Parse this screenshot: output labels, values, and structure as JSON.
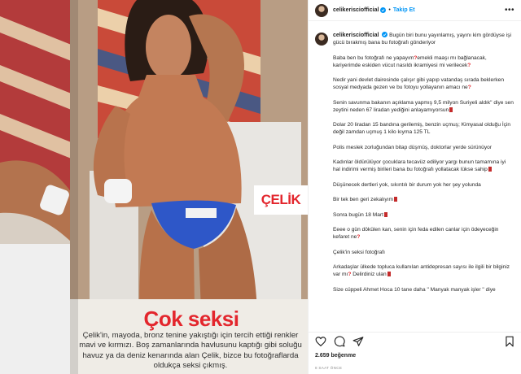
{
  "post": {
    "username": "celikerisciofficial",
    "follow_label": "Takip Et",
    "dot": "•",
    "more_icon": "more-icon",
    "likes": "2.659 beğenme",
    "time": "8 SAAT ÖNCE",
    "caption": {
      "p1": "Bugün biri bunu yayınlamış, yayını kim gördüyse işi gücü bırakmış bana bu fotoğrafı gönderiyor",
      "p2a": "Baba ben bu fotoğrafı ne yapayım",
      "p2b": "emekli maaşı mı bağlanacak, kariyerimde eskiden vücut nasıldı ikramiyesi mi verilecek",
      "p3a": "Nedir yani devlet dairesinde çalışır gibi yapıp vatandaş sırada beklerken sosyal medyada gezen ve bu fotoyu yollayanın amacı ne",
      "p4": "Senin savunma bakanın açıklama yapmış 9,5 milyon Suriyeli aldık\" diye sen zeytini neden 67 liradan yediğini anlayamıyorsun",
      "p5": "Dolar 20 liradan 15 bandına gerilemiş, benzin uçmuş; Kimyasal olduğu İçin değil zamdan uçmuş 1 kilo kıyma 125 TL",
      "p6": "Polis meslek zorluğundan bitap düşmüş, doktorlar yerde sürünüyor",
      "p7": "Kadınlar öldürülüyor çocuklara tecavüz ediliyor yargı bunun tamamına iyi hal indirimi vermiş birileri bana bu fotoğrafı yollatacak lükse sahip",
      "p8": "Düşünecek dertleri yok, sıkıntılı bir durum yok her şey yolunda",
      "p9": "Bir tek ben geri zekalıyım",
      "p10": "Sonra bugün 18 Mart",
      "p11": "Eeee o gün dökülen kan, senin için feda edilen canlar için ödeyeceğin kefaret ne",
      "p12": "Çelik'in seksi fotoğrafı",
      "p13a": "Arkadaşlar ülkede topluca kullanılan antidepresan sayısı ile ilgili bir bilginiz var mı",
      "p13b": "Delirdiniz ulan",
      "p14": "Size cüppeli Ahmet Hoca 10 tane daha \" Manyak manyak işler \" diye"
    }
  },
  "magazine": {
    "headline": "Çok seksi",
    "caption": "Çelik'in, mayoda, bronz tenine yakıştığı için tercih ettiği renkler mavi ve kırmızı. Boş zamanlarında havlusunu kaptığı gibi soluğu havuz ya da deniz kenarında alan Çelik, bizce bu fotoğraflarda oldukça seksi çıkmış.",
    "tag": "ÇELİK"
  },
  "colors": {
    "accent": "#0095f6",
    "headline": "#e3262d",
    "swimsuit": "#2e57c8"
  },
  "icons": [
    "heart-icon",
    "comment-icon",
    "share-icon",
    "bookmark-icon",
    "verified-icon"
  ]
}
